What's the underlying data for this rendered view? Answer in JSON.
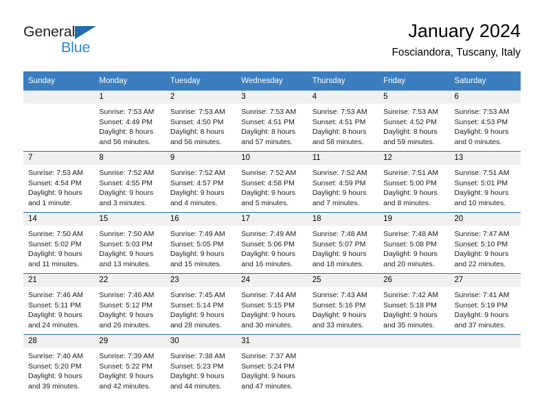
{
  "brand": {
    "name_top": "General",
    "name_bottom": "Blue",
    "color_dark": "#231f20",
    "color_blue": "#2b87d3",
    "triangle_color": "#1f6cb0"
  },
  "header": {
    "title": "January 2024",
    "subtitle": "Fosciandora, Tuscany, Italy"
  },
  "theme": {
    "header_row_bg": "#3a7ebf",
    "week_divider": "#1f6cb0",
    "daynum_band_bg": "#f0f0f0"
  },
  "weekday_headers": [
    "Sunday",
    "Monday",
    "Tuesday",
    "Wednesday",
    "Thursday",
    "Friday",
    "Saturday"
  ],
  "weeks": [
    [
      {
        "day": "",
        "empty": true
      },
      {
        "day": "1",
        "sunrise": "Sunrise: 7:53 AM",
        "sunset": "Sunset: 4:49 PM",
        "daylight1": "Daylight: 8 hours",
        "daylight2": "and 56 minutes."
      },
      {
        "day": "2",
        "sunrise": "Sunrise: 7:53 AM",
        "sunset": "Sunset: 4:50 PM",
        "daylight1": "Daylight: 8 hours",
        "daylight2": "and 56 minutes."
      },
      {
        "day": "3",
        "sunrise": "Sunrise: 7:53 AM",
        "sunset": "Sunset: 4:51 PM",
        "daylight1": "Daylight: 8 hours",
        "daylight2": "and 57 minutes."
      },
      {
        "day": "4",
        "sunrise": "Sunrise: 7:53 AM",
        "sunset": "Sunset: 4:51 PM",
        "daylight1": "Daylight: 8 hours",
        "daylight2": "and 58 minutes."
      },
      {
        "day": "5",
        "sunrise": "Sunrise: 7:53 AM",
        "sunset": "Sunset: 4:52 PM",
        "daylight1": "Daylight: 8 hours",
        "daylight2": "and 59 minutes."
      },
      {
        "day": "6",
        "sunrise": "Sunrise: 7:53 AM",
        "sunset": "Sunset: 4:53 PM",
        "daylight1": "Daylight: 9 hours",
        "daylight2": "and 0 minutes."
      }
    ],
    [
      {
        "day": "7",
        "sunrise": "Sunrise: 7:53 AM",
        "sunset": "Sunset: 4:54 PM",
        "daylight1": "Daylight: 9 hours",
        "daylight2": "and 1 minute."
      },
      {
        "day": "8",
        "sunrise": "Sunrise: 7:52 AM",
        "sunset": "Sunset: 4:55 PM",
        "daylight1": "Daylight: 9 hours",
        "daylight2": "and 3 minutes."
      },
      {
        "day": "9",
        "sunrise": "Sunrise: 7:52 AM",
        "sunset": "Sunset: 4:57 PM",
        "daylight1": "Daylight: 9 hours",
        "daylight2": "and 4 minutes."
      },
      {
        "day": "10",
        "sunrise": "Sunrise: 7:52 AM",
        "sunset": "Sunset: 4:58 PM",
        "daylight1": "Daylight: 9 hours",
        "daylight2": "and 5 minutes."
      },
      {
        "day": "11",
        "sunrise": "Sunrise: 7:52 AM",
        "sunset": "Sunset: 4:59 PM",
        "daylight1": "Daylight: 9 hours",
        "daylight2": "and 7 minutes."
      },
      {
        "day": "12",
        "sunrise": "Sunrise: 7:51 AM",
        "sunset": "Sunset: 5:00 PM",
        "daylight1": "Daylight: 9 hours",
        "daylight2": "and 8 minutes."
      },
      {
        "day": "13",
        "sunrise": "Sunrise: 7:51 AM",
        "sunset": "Sunset: 5:01 PM",
        "daylight1": "Daylight: 9 hours",
        "daylight2": "and 10 minutes."
      }
    ],
    [
      {
        "day": "14",
        "sunrise": "Sunrise: 7:50 AM",
        "sunset": "Sunset: 5:02 PM",
        "daylight1": "Daylight: 9 hours",
        "daylight2": "and 11 minutes."
      },
      {
        "day": "15",
        "sunrise": "Sunrise: 7:50 AM",
        "sunset": "Sunset: 5:03 PM",
        "daylight1": "Daylight: 9 hours",
        "daylight2": "and 13 minutes."
      },
      {
        "day": "16",
        "sunrise": "Sunrise: 7:49 AM",
        "sunset": "Sunset: 5:05 PM",
        "daylight1": "Daylight: 9 hours",
        "daylight2": "and 15 minutes."
      },
      {
        "day": "17",
        "sunrise": "Sunrise: 7:49 AM",
        "sunset": "Sunset: 5:06 PM",
        "daylight1": "Daylight: 9 hours",
        "daylight2": "and 16 minutes."
      },
      {
        "day": "18",
        "sunrise": "Sunrise: 7:48 AM",
        "sunset": "Sunset: 5:07 PM",
        "daylight1": "Daylight: 9 hours",
        "daylight2": "and 18 minutes."
      },
      {
        "day": "19",
        "sunrise": "Sunrise: 7:48 AM",
        "sunset": "Sunset: 5:08 PM",
        "daylight1": "Daylight: 9 hours",
        "daylight2": "and 20 minutes."
      },
      {
        "day": "20",
        "sunrise": "Sunrise: 7:47 AM",
        "sunset": "Sunset: 5:10 PM",
        "daylight1": "Daylight: 9 hours",
        "daylight2": "and 22 minutes."
      }
    ],
    [
      {
        "day": "21",
        "sunrise": "Sunrise: 7:46 AM",
        "sunset": "Sunset: 5:11 PM",
        "daylight1": "Daylight: 9 hours",
        "daylight2": "and 24 minutes."
      },
      {
        "day": "22",
        "sunrise": "Sunrise: 7:46 AM",
        "sunset": "Sunset: 5:12 PM",
        "daylight1": "Daylight: 9 hours",
        "daylight2": "and 26 minutes."
      },
      {
        "day": "23",
        "sunrise": "Sunrise: 7:45 AM",
        "sunset": "Sunset: 5:14 PM",
        "daylight1": "Daylight: 9 hours",
        "daylight2": "and 28 minutes."
      },
      {
        "day": "24",
        "sunrise": "Sunrise: 7:44 AM",
        "sunset": "Sunset: 5:15 PM",
        "daylight1": "Daylight: 9 hours",
        "daylight2": "and 30 minutes."
      },
      {
        "day": "25",
        "sunrise": "Sunrise: 7:43 AM",
        "sunset": "Sunset: 5:16 PM",
        "daylight1": "Daylight: 9 hours",
        "daylight2": "and 33 minutes."
      },
      {
        "day": "26",
        "sunrise": "Sunrise: 7:42 AM",
        "sunset": "Sunset: 5:18 PM",
        "daylight1": "Daylight: 9 hours",
        "daylight2": "and 35 minutes."
      },
      {
        "day": "27",
        "sunrise": "Sunrise: 7:41 AM",
        "sunset": "Sunset: 5:19 PM",
        "daylight1": "Daylight: 9 hours",
        "daylight2": "and 37 minutes."
      }
    ],
    [
      {
        "day": "28",
        "sunrise": "Sunrise: 7:40 AM",
        "sunset": "Sunset: 5:20 PM",
        "daylight1": "Daylight: 9 hours",
        "daylight2": "and 39 minutes."
      },
      {
        "day": "29",
        "sunrise": "Sunrise: 7:39 AM",
        "sunset": "Sunset: 5:22 PM",
        "daylight1": "Daylight: 9 hours",
        "daylight2": "and 42 minutes."
      },
      {
        "day": "30",
        "sunrise": "Sunrise: 7:38 AM",
        "sunset": "Sunset: 5:23 PM",
        "daylight1": "Daylight: 9 hours",
        "daylight2": "and 44 minutes."
      },
      {
        "day": "31",
        "sunrise": "Sunrise: 7:37 AM",
        "sunset": "Sunset: 5:24 PM",
        "daylight1": "Daylight: 9 hours",
        "daylight2": "and 47 minutes."
      },
      {
        "day": "",
        "empty": true
      },
      {
        "day": "",
        "empty": true
      },
      {
        "day": "",
        "empty": true
      }
    ]
  ]
}
